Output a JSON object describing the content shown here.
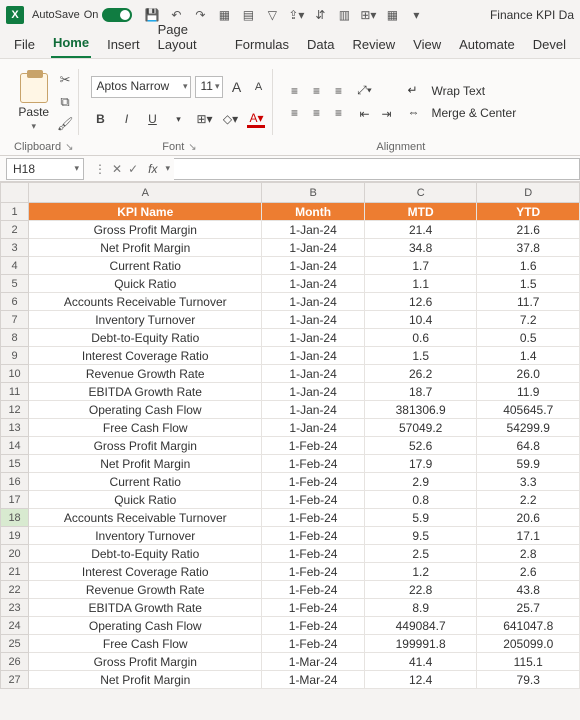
{
  "titlebar": {
    "autosave_label": "AutoSave",
    "autosave_state": "On",
    "doc_title": "Finance KPI Da"
  },
  "tabs": [
    "File",
    "Home",
    "Insert",
    "Page Layout",
    "Formulas",
    "Data",
    "Review",
    "View",
    "Automate",
    "Devel"
  ],
  "active_tab": "Home",
  "font": {
    "name": "Aptos Narrow",
    "size": "11",
    "bold": "B",
    "italic": "I",
    "underline": "U",
    "increase": "A",
    "decrease": "A"
  },
  "groups": {
    "clipboard": "Clipboard",
    "font": "Font",
    "alignment": "Alignment",
    "paste": "Paste",
    "wrap": "Wrap Text",
    "merge": "Merge & Center"
  },
  "namebox": "H18",
  "fx": "fx",
  "columns": [
    "A",
    "B",
    "C",
    "D"
  ],
  "header_row": [
    "KPI Name",
    "Month",
    "MTD",
    "YTD"
  ],
  "rows": [
    [
      "Gross Profit Margin",
      "1-Jan-24",
      "21.4",
      "21.6"
    ],
    [
      "Net Profit Margin",
      "1-Jan-24",
      "34.8",
      "37.8"
    ],
    [
      "Current Ratio",
      "1-Jan-24",
      "1.7",
      "1.6"
    ],
    [
      "Quick Ratio",
      "1-Jan-24",
      "1.1",
      "1.5"
    ],
    [
      "Accounts Receivable Turnover",
      "1-Jan-24",
      "12.6",
      "11.7"
    ],
    [
      "Inventory Turnover",
      "1-Jan-24",
      "10.4",
      "7.2"
    ],
    [
      "Debt-to-Equity Ratio",
      "1-Jan-24",
      "0.6",
      "0.5"
    ],
    [
      "Interest Coverage Ratio",
      "1-Jan-24",
      "1.5",
      "1.4"
    ],
    [
      "Revenue Growth Rate",
      "1-Jan-24",
      "26.2",
      "26.0"
    ],
    [
      "EBITDA Growth Rate",
      "1-Jan-24",
      "18.7",
      "11.9"
    ],
    [
      "Operating Cash Flow",
      "1-Jan-24",
      "381306.9",
      "405645.7"
    ],
    [
      "Free Cash Flow",
      "1-Jan-24",
      "57049.2",
      "54299.9"
    ],
    [
      "Gross Profit Margin",
      "1-Feb-24",
      "52.6",
      "64.8"
    ],
    [
      "Net Profit Margin",
      "1-Feb-24",
      "17.9",
      "59.9"
    ],
    [
      "Current Ratio",
      "1-Feb-24",
      "2.9",
      "3.3"
    ],
    [
      "Quick Ratio",
      "1-Feb-24",
      "0.8",
      "2.2"
    ],
    [
      "Accounts Receivable Turnover",
      "1-Feb-24",
      "5.9",
      "20.6"
    ],
    [
      "Inventory Turnover",
      "1-Feb-24",
      "9.5",
      "17.1"
    ],
    [
      "Debt-to-Equity Ratio",
      "1-Feb-24",
      "2.5",
      "2.8"
    ],
    [
      "Interest Coverage Ratio",
      "1-Feb-24",
      "1.2",
      "2.6"
    ],
    [
      "Revenue Growth Rate",
      "1-Feb-24",
      "22.8",
      "43.8"
    ],
    [
      "EBITDA Growth Rate",
      "1-Feb-24",
      "8.9",
      "25.7"
    ],
    [
      "Operating Cash Flow",
      "1-Feb-24",
      "449084.7",
      "641047.8"
    ],
    [
      "Free Cash Flow",
      "1-Feb-24",
      "199991.8",
      "205099.0"
    ],
    [
      "Gross Profit Margin",
      "1-Mar-24",
      "41.4",
      "115.1"
    ],
    [
      "Net Profit Margin",
      "1-Mar-24",
      "12.4",
      "79.3"
    ]
  ],
  "selected_row": 18
}
